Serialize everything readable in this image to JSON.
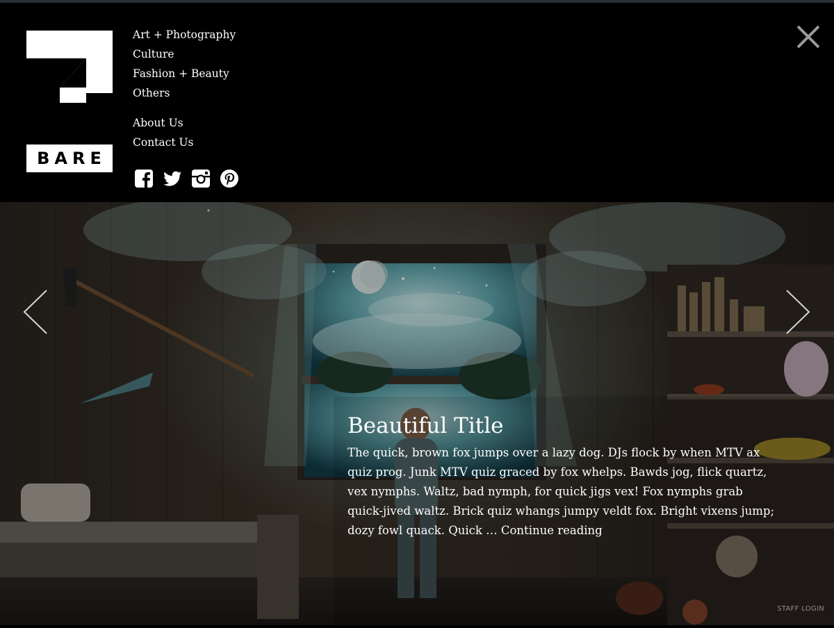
{
  "brand": {
    "name": "BARE"
  },
  "nav": {
    "categories": [
      {
        "label": "Art + Photography"
      },
      {
        "label": "Culture"
      },
      {
        "label": "Fashion + Beauty"
      },
      {
        "label": "Others"
      }
    ],
    "pages": [
      {
        "label": "About Us"
      },
      {
        "label": "Contact Us"
      }
    ]
  },
  "social": [
    "facebook-icon",
    "twitter-icon",
    "instagram-icon",
    "pinterest-icon"
  ],
  "slider": {
    "title": "Beautiful Title",
    "excerpt": "The quick, brown fox jumps over a lazy dog. DJs flock by when MTV ax quiz prog. Junk MTV quiz graced by fox whelps. Bawds jog, flick quartz, vex nymphs. Waltz, bad nymph, for quick jigs vex! Fox nymphs grab quick-jived waltz. Brick quiz whangs jumpy veldt fox. Bright vixens jump; dozy fowl quack. Quick …",
    "continue_label": "Continue reading"
  },
  "footer": {
    "staff_login": "STAFF LOGIN"
  },
  "colors": {
    "header_bg": "#000000",
    "text": "#ffffff",
    "muted": "#8e8e8e"
  }
}
